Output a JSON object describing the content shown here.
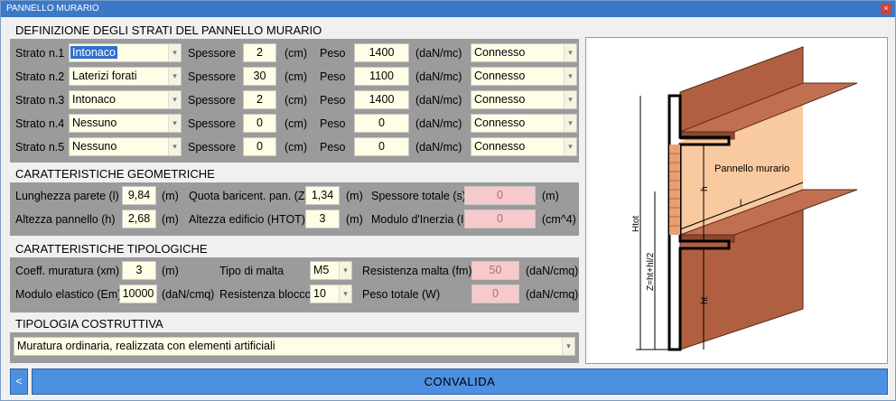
{
  "window": {
    "title": "PANNELLO MURARIO",
    "close_glyph": "×"
  },
  "layers_section": {
    "title": "DEFINIZIONE DEGLI STRATI DEL PANNELLO MURARIO",
    "rows": [
      {
        "label": "Strato n.1",
        "material": "Intonaco",
        "thickness_label": "Spessore",
        "thickness": "2",
        "thickness_unit": "(cm)",
        "weight_label": "Peso",
        "weight": "1400",
        "weight_unit": "(daN/mc)",
        "connection": "Connesso"
      },
      {
        "label": "Strato n.2",
        "material": "Laterizi forati",
        "thickness_label": "Spessore",
        "thickness": "30",
        "thickness_unit": "(cm)",
        "weight_label": "Peso",
        "weight": "1100",
        "weight_unit": "(daN/mc)",
        "connection": "Connesso"
      },
      {
        "label": "Strato n.3",
        "material": "Intonaco",
        "thickness_label": "Spessore",
        "thickness": "2",
        "thickness_unit": "(cm)",
        "weight_label": "Peso",
        "weight": "1400",
        "weight_unit": "(daN/mc)",
        "connection": "Connesso"
      },
      {
        "label": "Strato n.4",
        "material": "Nessuno",
        "thickness_label": "Spessore",
        "thickness": "0",
        "thickness_unit": "(cm)",
        "weight_label": "Peso",
        "weight": "0",
        "weight_unit": "(daN/mc)",
        "connection": "Connesso"
      },
      {
        "label": "Strato n.5",
        "material": "Nessuno",
        "thickness_label": "Spessore",
        "thickness": "0",
        "thickness_unit": "(cm)",
        "weight_label": "Peso",
        "weight": "0",
        "weight_unit": "(daN/mc)",
        "connection": "Connesso"
      }
    ]
  },
  "geometry_section": {
    "title": "CARATTERISTICHE GEOMETRICHE",
    "wall_length": {
      "label": "Lunghezza parete (l)",
      "value": "9,84",
      "unit": "(m)"
    },
    "panel_height": {
      "label": "Altezza pannello (h)",
      "value": "2,68",
      "unit": "(m)"
    },
    "centroid_height": {
      "label": "Quota baricent. pan. (Z)",
      "value": "1,34",
      "unit": "(m)"
    },
    "building_height": {
      "label": "Altezza edificio (HTOT)",
      "value": "3",
      "unit": "(m)"
    },
    "total_thickness": {
      "label": "Spessore totale (s)",
      "value": "0",
      "unit": "(m)"
    },
    "inertia_modulus": {
      "label": "Modulo d'Inerzia (I)",
      "value": "0",
      "unit": "(cm^4)"
    }
  },
  "typology_section": {
    "title": "CARATTERISTICHE TIPOLOGICHE",
    "masonry_coeff": {
      "label": "Coeff. muratura (xm)",
      "value": "3",
      "unit": "(m)"
    },
    "elastic_modulus": {
      "label": "Modulo elastico (Em)",
      "value": "10000",
      "unit": "(daN/cmq)"
    },
    "mortar_type": {
      "label": "Tipo di malta",
      "value": "M5"
    },
    "block_strength": {
      "label": "Resistenza blocco",
      "value": "10"
    },
    "mortar_strength": {
      "label": "Resistenza malta (fm)",
      "value": "50",
      "unit": "(daN/cmq)"
    },
    "total_weight": {
      "label": "Peso totale (W)",
      "value": "0",
      "unit": "(daN/cmq)"
    }
  },
  "construction_section": {
    "title": "TIPOLOGIA COSTRUTTIVA",
    "value": "Muratura ordinaria, realizzata con elementi artificiali"
  },
  "figure": {
    "panel_label": "Pannello murario",
    "h_label": "h",
    "l_label": "l",
    "htot_label": "Htot",
    "z_label": "Z=ht+hl/2",
    "ht_label": "ht"
  },
  "footer": {
    "back_label": "<",
    "confirm_label": "CONVALIDA"
  },
  "colors": {
    "title_bar": "#3c78c8",
    "panel_gray": "#9b9b9b",
    "input_bg": "#fffde5",
    "readonly_bg": "#f8c9cb",
    "button_blue": "#4d8fe0",
    "wall_brown": "#b06040",
    "wall_light": "#f9c9a0"
  }
}
